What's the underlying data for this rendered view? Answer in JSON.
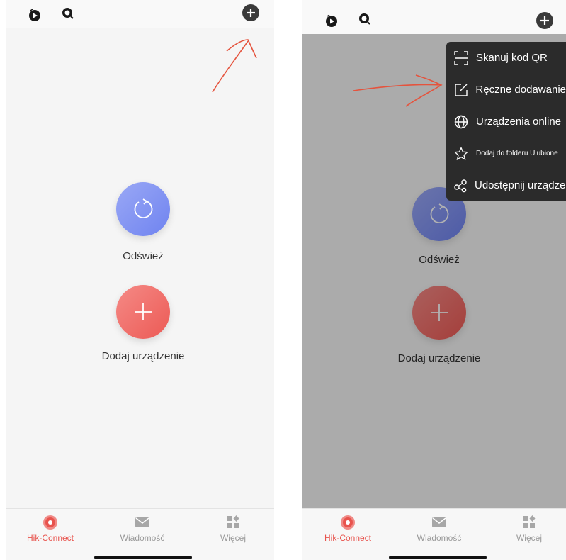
{
  "colors": {
    "accent_red": "#e8534d",
    "refresh_blue": "#7b8df2",
    "menu_bg": "#2b2b2b",
    "annotation": "#e5533d"
  },
  "left_screen": {
    "main": {
      "refresh_label": "Odśwież",
      "add_device_label": "Dodaj urządzenie"
    },
    "tabs": [
      {
        "label": "Hik-Connect",
        "icon": "hik-connect-icon",
        "active": true
      },
      {
        "label": "Wiadomość",
        "icon": "envelope-icon",
        "active": false
      },
      {
        "label": "Więcej",
        "icon": "grid-more-icon",
        "active": false
      }
    ]
  },
  "right_screen": {
    "menu": [
      {
        "label": "Skanuj kod QR",
        "icon": "scan-qr-icon"
      },
      {
        "label": "Ręczne dodawanie",
        "icon": "edit-icon"
      },
      {
        "label": "Urządzenia online",
        "icon": "globe-icon"
      },
      {
        "label": "Dodaj do folderu Ulubione",
        "icon": "star-icon"
      },
      {
        "label": "Udostępnij urządzenie",
        "icon": "share-icon"
      }
    ],
    "main": {
      "refresh_label": "Odśwież",
      "add_device_label": "Dodaj urządzenie"
    },
    "tabs": [
      {
        "label": "Hik-Connect",
        "icon": "hik-connect-icon",
        "active": true
      },
      {
        "label": "Wiadomość",
        "icon": "envelope-icon",
        "active": false
      },
      {
        "label": "Więcej",
        "icon": "grid-more-icon",
        "active": false
      }
    ]
  }
}
